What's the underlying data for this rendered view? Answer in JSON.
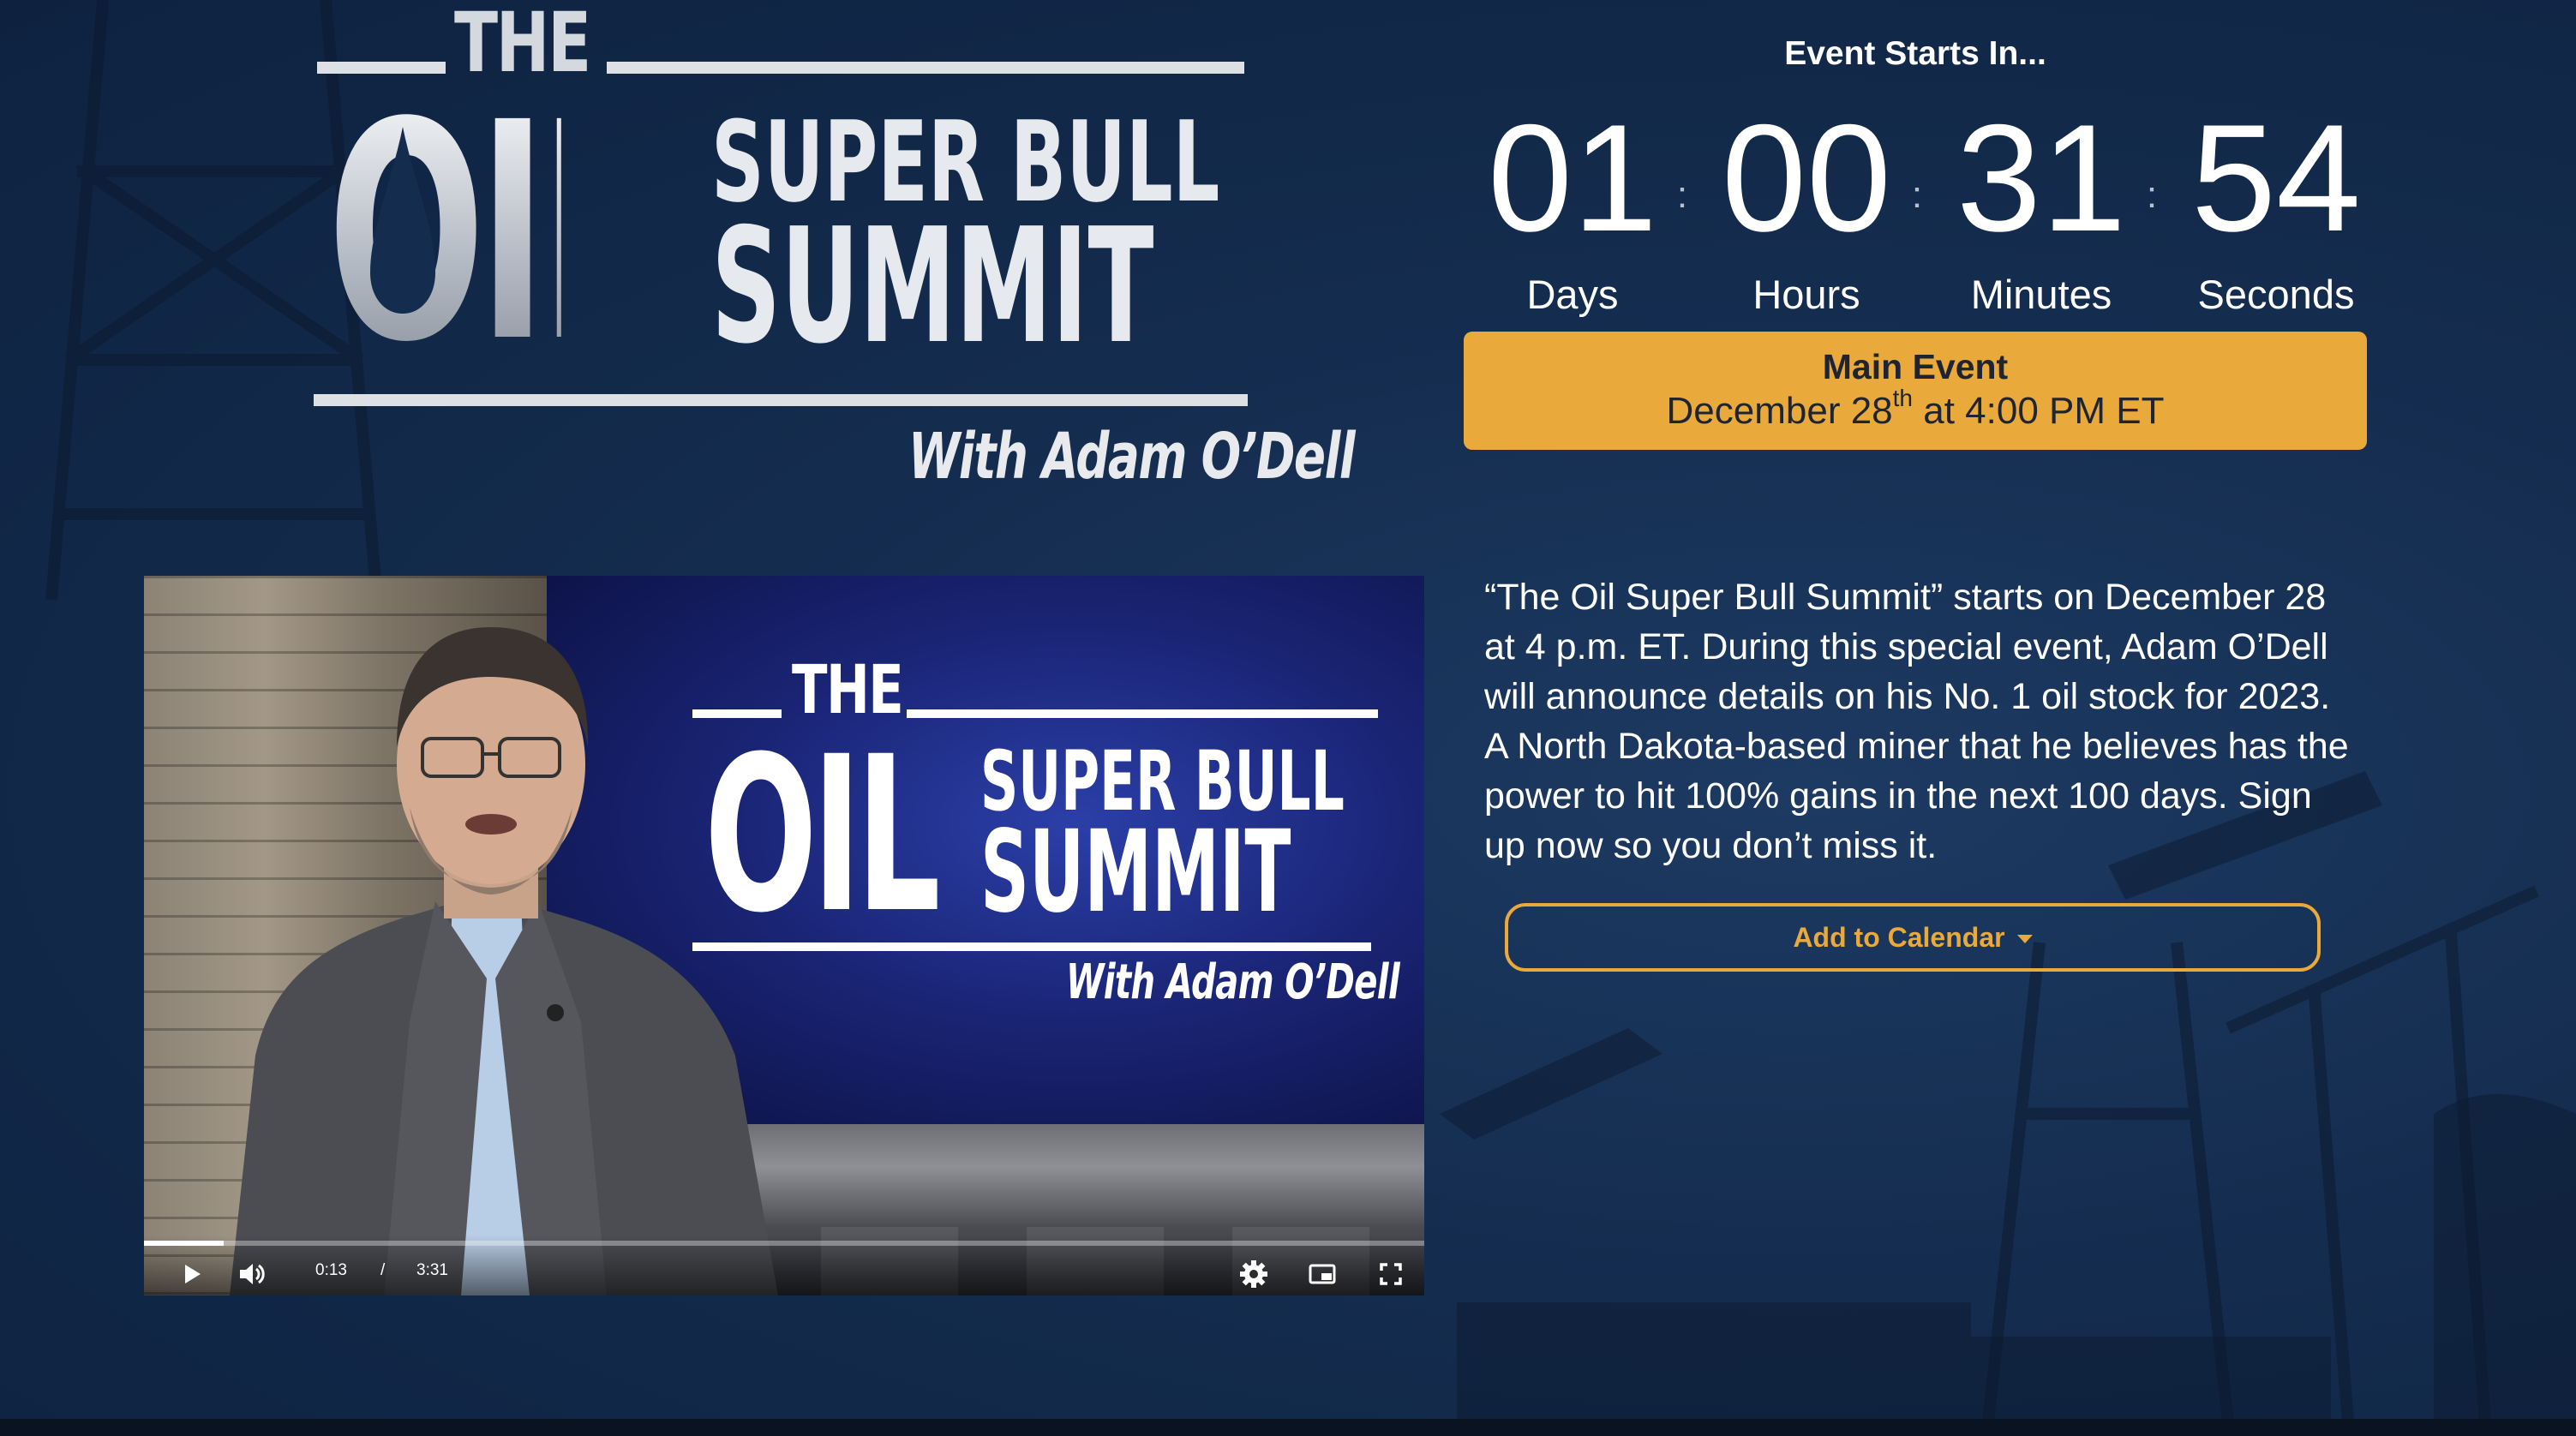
{
  "logo": {
    "the": "THE",
    "oil": "OIL",
    "super_bull": "SUPER BULL",
    "summit": "SUMMIT",
    "byline": "With Adam O’Dell"
  },
  "countdown": {
    "header": "Event Starts In...",
    "units": [
      {
        "value": "01",
        "label": "Days"
      },
      {
        "value": "00",
        "label": "Hours"
      },
      {
        "value": "31",
        "label": "Minutes"
      },
      {
        "value": "54",
        "label": "Seconds"
      }
    ],
    "separator": ":"
  },
  "main_event": {
    "title": "Main Event",
    "date_prefix": "December 28",
    "date_suffix": "th",
    "date_rest": " at 4:00 PM ET"
  },
  "description": "“The Oil Super Bull Summit” starts on December 28 at 4 p.m. ET. During this special event, Adam O’Dell will announce details on his No. 1 oil stock for 2023. A North Dakota-based miner that he believes has the power to hit 100% gains in the next 100 days. Sign up now so you don’t miss it.",
  "calendar_button": {
    "label": "Add to Calendar",
    "icon": "caret-down-icon"
  },
  "video": {
    "current_time": "0:13",
    "time_separator": "/",
    "duration": "3:31",
    "progress_fraction": 0.062,
    "on_screen_logo": {
      "the": "THE",
      "oil": "OIL",
      "super_bull": "SUPER BULL",
      "summit": "SUMMIT",
      "byline": "With Adam O’Dell"
    },
    "controls": [
      "play-icon",
      "volume-icon",
      "settings-gear-icon",
      "picture-in-picture-icon",
      "fullscreen-icon"
    ]
  },
  "colors": {
    "background": "#142c4e",
    "accent": "#eaa93b",
    "text": "#ffffff"
  }
}
